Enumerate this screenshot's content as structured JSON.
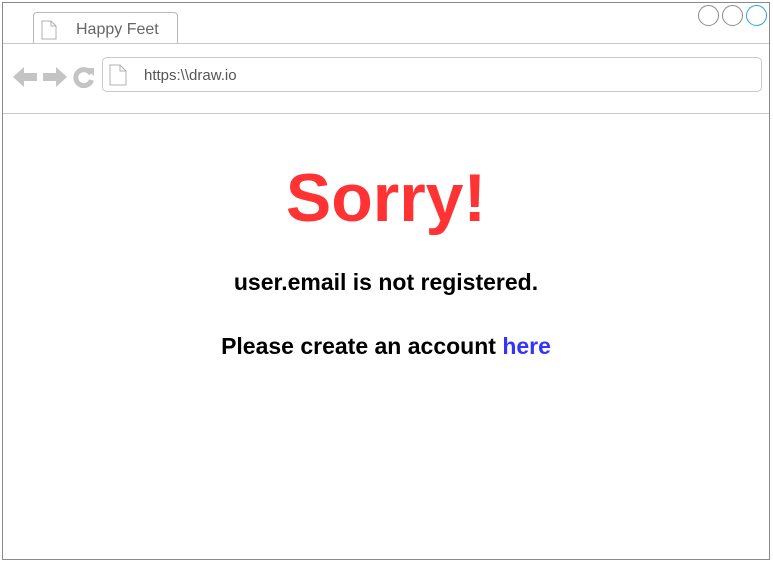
{
  "browser": {
    "tab": {
      "title": "Happy Feet",
      "icon": "page-icon"
    },
    "window_controls": [
      "minimize-icon",
      "maximize-icon",
      "close-icon"
    ],
    "nav": {
      "back_icon": "arrow-left-icon",
      "forward_icon": "arrow-right-icon",
      "reload_icon": "reload-icon"
    },
    "address_bar": {
      "url": "https:\\\\draw.io",
      "icon": "page-icon"
    }
  },
  "page": {
    "heading": "Sorry!",
    "message": "user.email is not registered.",
    "cta_prefix": "Please create an account",
    "cta_link": "here"
  },
  "colors": {
    "heading": "#ff3333",
    "link": "#3333ff",
    "close_control": "#2aa5e0"
  }
}
